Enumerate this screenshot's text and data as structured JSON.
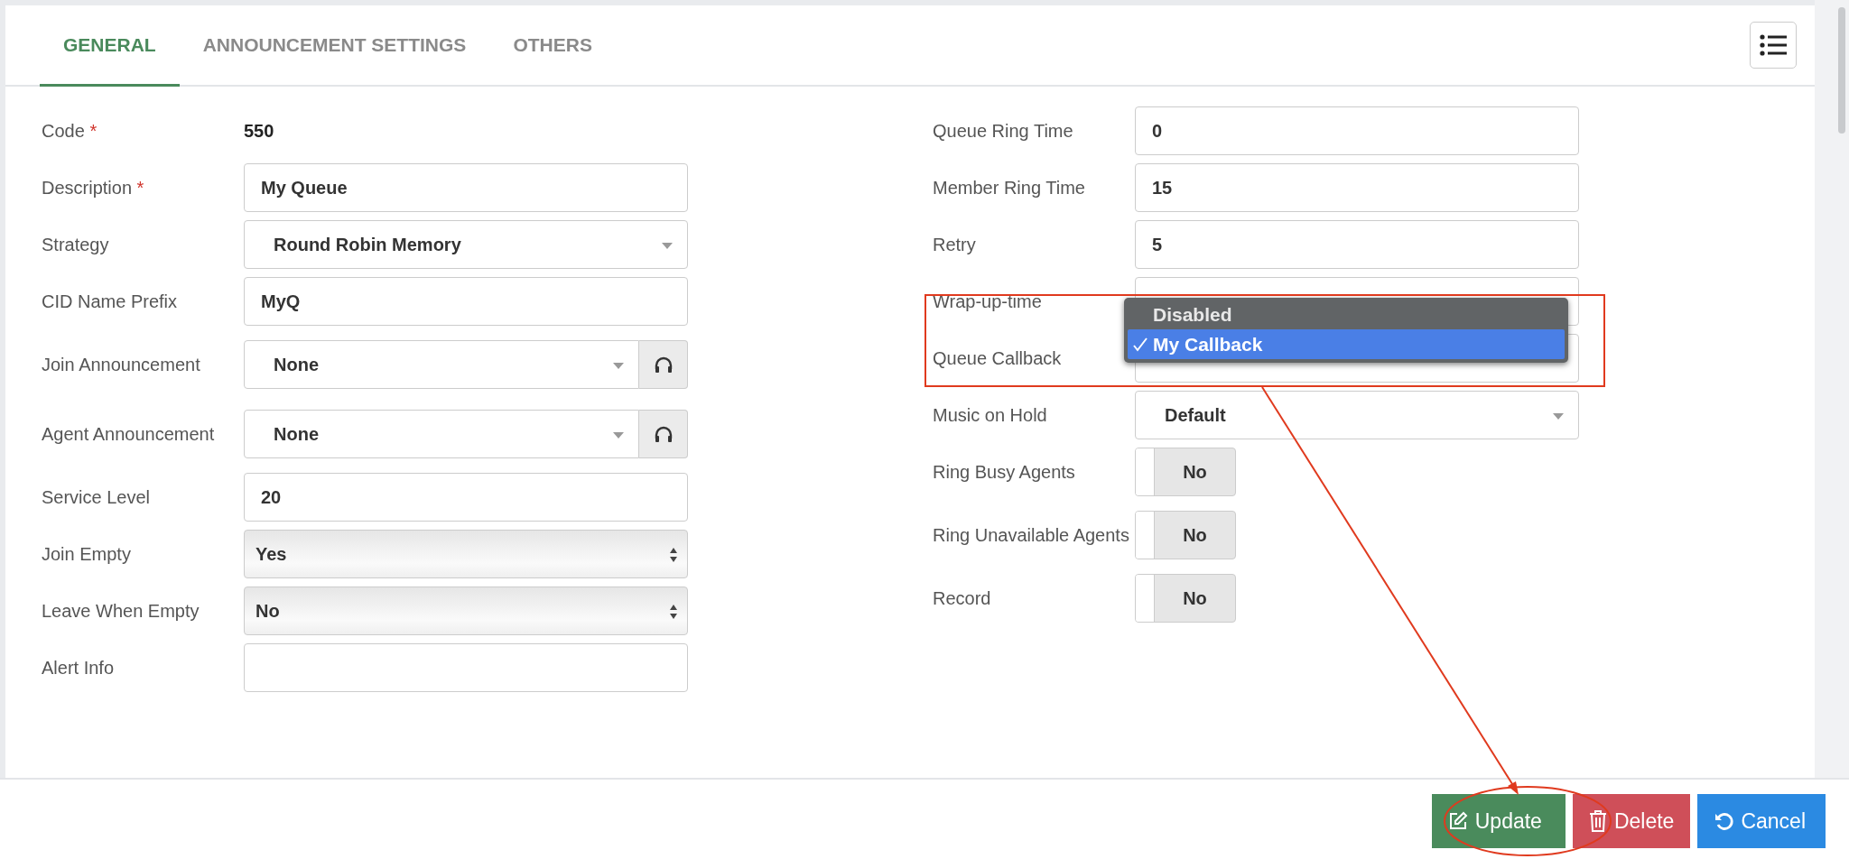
{
  "tabs": [
    {
      "label": "GENERAL",
      "selected": true
    },
    {
      "label": "ANNOUNCEMENT SETTINGS",
      "selected": false
    },
    {
      "label": "OTHERS",
      "selected": false
    }
  ],
  "left_fields": [
    {
      "label": "Code",
      "required_mark": "*",
      "kind": "static",
      "value": "550"
    },
    {
      "label": "Description",
      "required_mark": "*",
      "kind": "text",
      "value": "My Queue"
    },
    {
      "label": "Strategy",
      "kind": "select",
      "value": "Round Robin Memory"
    },
    {
      "label": "CID Name Prefix",
      "kind": "text",
      "value": "MyQ"
    },
    {
      "label": "Join Announcement",
      "kind": "select_audio",
      "value": "None"
    },
    {
      "label": "Agent Announcement",
      "kind": "select_audio",
      "value": "None"
    },
    {
      "label": "Service Level",
      "kind": "text",
      "value": "20"
    },
    {
      "label": "Join Empty",
      "kind": "native_select",
      "value": "Yes"
    },
    {
      "label": "Leave When Empty",
      "kind": "native_select",
      "value": "No"
    },
    {
      "label": "Alert Info",
      "kind": "text"
    }
  ],
  "right_fields": [
    {
      "label": "Queue Ring Time",
      "kind": "text",
      "value": "0"
    },
    {
      "label": "Member Ring Time",
      "kind": "text",
      "value": "15"
    },
    {
      "label": "Retry",
      "kind": "text",
      "value": "5"
    },
    {
      "label": "Wrap-up-time",
      "kind": "text"
    },
    {
      "label": "Queue Callback",
      "kind": "select_open"
    },
    {
      "label": "Music on Hold",
      "kind": "select",
      "value": "Default"
    },
    {
      "label": "Ring Busy Agents",
      "kind": "toggle",
      "value": "No",
      "on": false
    },
    {
      "label": "Ring Unavailable Agents",
      "kind": "toggle",
      "value": "No",
      "on": false
    },
    {
      "label": "Record",
      "kind": "toggle",
      "value": "No",
      "on": false
    }
  ],
  "callback_dropdown": [
    {
      "label": "Disabled",
      "selected": false
    },
    {
      "label": "My Callback",
      "selected": true
    }
  ],
  "buttons": [
    {
      "label": "Update",
      "kind": "update"
    },
    {
      "label": "Delete",
      "kind": "delete"
    },
    {
      "label": "Cancel",
      "kind": "cancel"
    }
  ]
}
